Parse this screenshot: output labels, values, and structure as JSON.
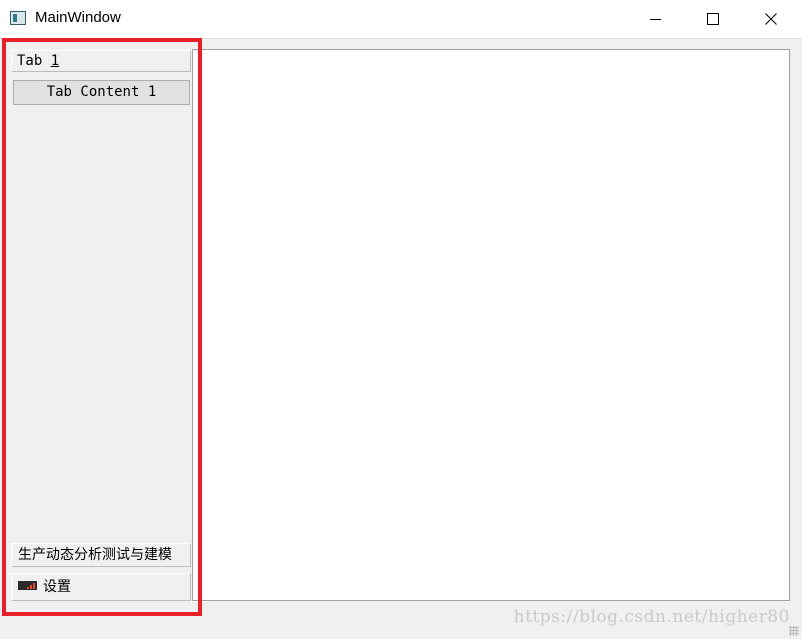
{
  "window": {
    "title": "MainWindow",
    "app_icon": "qt-app-icon",
    "minimize_icon": "minimize-icon",
    "maximize_icon": "maximize-icon",
    "close_icon": "close-icon"
  },
  "toolbox": {
    "tabs": [
      {
        "label_prefix": "Tab ",
        "label_mnemonic": "1",
        "content_button": "Tab Content 1"
      },
      {
        "label": "生产动态分析测试与建模"
      },
      {
        "label": "设置",
        "icon": "signal-bars-icon"
      }
    ]
  },
  "colors": {
    "highlight": "#e8202a",
    "window_bg": "#f0f0f0",
    "main_area_bg": "#ffffff"
  },
  "watermark": "https://blog.csdn.net/higher80"
}
